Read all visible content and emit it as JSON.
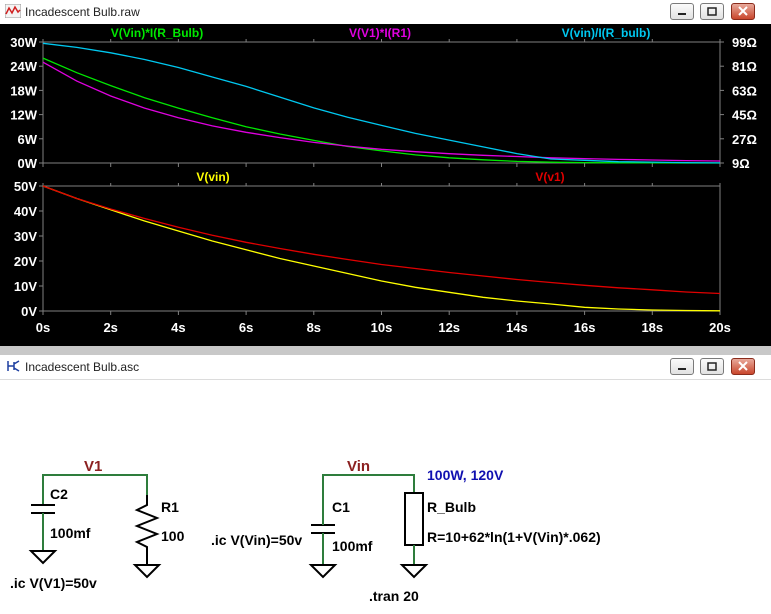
{
  "waveform_window": {
    "title": "Incadescent Bulb.raw",
    "controls": {
      "minimize": "minimize",
      "restore": "restore",
      "close": "close"
    }
  },
  "schematic_window": {
    "title": "Incadescent Bulb.asc",
    "controls": {
      "minimize": "minimize",
      "restore": "restore",
      "close": "close"
    },
    "nets": {
      "v1": "V1",
      "vin": "Vin"
    },
    "components": {
      "c2": {
        "name": "C2",
        "value": "100mf"
      },
      "r1": {
        "name": "R1",
        "value": "100"
      },
      "c1": {
        "name": "C1",
        "value": "100mf"
      },
      "r_bulb": {
        "name": "R_Bulb",
        "value": "R=10+62*ln(1+V(Vin)*.062)",
        "rating": "100W, 120V"
      }
    },
    "directives": {
      "ic_v1": ".ic V(V1)=50v",
      "ic_vin": ".ic V(Vin)=50v",
      "tran": ".tran 20"
    }
  },
  "colors": {
    "background": "#000000",
    "axis": "#808080",
    "label": "#ffffff",
    "green": "#00e800",
    "magenta": "#e000e0",
    "cyan": "#00c8f0",
    "yellow": "#ffff00",
    "red": "#e00000",
    "netlabel": "#8b2020",
    "rating": "#1010b0",
    "wire": "#2e7d3c"
  },
  "chart_data": [
    {
      "type": "line",
      "title": "",
      "x_ticks": [
        "0s",
        "2s",
        "4s",
        "6s",
        "8s",
        "10s",
        "12s",
        "14s",
        "16s",
        "18s",
        "20s"
      ],
      "xlim": [
        0,
        20
      ],
      "ylim_left": [
        0,
        30
      ],
      "y_ticks_left": [
        "0W",
        "6W",
        "12W",
        "18W",
        "24W",
        "30W"
      ],
      "ylim_right": [
        9,
        99
      ],
      "y_ticks_right": [
        "9Ω",
        "27Ω",
        "45Ω",
        "63Ω",
        "81Ω",
        "99Ω"
      ],
      "series": [
        {
          "name": "V(Vin)*I(R_Bulb)",
          "color": "#00e800",
          "axis": "left",
          "x": [
            0,
            1,
            2,
            3,
            4,
            5,
            6,
            7,
            8,
            9,
            10,
            11,
            12,
            13,
            14,
            15,
            16,
            17,
            18,
            19,
            20
          ],
          "y": [
            26,
            22.4,
            19.2,
            16.2,
            13.6,
            11.2,
            9,
            7.2,
            5.6,
            4.1,
            3,
            2,
            1.3,
            0.8,
            0.4,
            0.2,
            0.1,
            0.05,
            0.02,
            0,
            0
          ]
        },
        {
          "name": "V(V1)*I(R1)",
          "color": "#e000e0",
          "axis": "left",
          "x": [
            0,
            1,
            2,
            3,
            4,
            5,
            6,
            7,
            8,
            9,
            10,
            11,
            12,
            13,
            14,
            15,
            16,
            17,
            18,
            19,
            20
          ],
          "y": [
            25,
            20.3,
            16.6,
            13.6,
            11.2,
            9.2,
            7.6,
            6.3,
            5.1,
            4.2,
            3.4,
            2.8,
            2.3,
            1.9,
            1.6,
            1.3,
            1.1,
            0.9,
            0.75,
            0.6,
            0.5
          ]
        },
        {
          "name": "V(vin)/I(R_bulb)",
          "color": "#00c8f0",
          "axis": "right",
          "x": [
            0,
            1,
            2,
            3,
            4,
            5,
            6,
            7,
            8,
            9,
            10,
            11,
            12,
            13,
            14,
            15,
            16,
            17,
            18,
            19,
            20
          ],
          "y": [
            98,
            95,
            91,
            86,
            80,
            73,
            66,
            58,
            50,
            43,
            37,
            31,
            26,
            21,
            16,
            12,
            11,
            10,
            9.7,
            9.3,
            9.1
          ]
        }
      ]
    },
    {
      "type": "line",
      "title": "",
      "x_ticks": [
        "0s",
        "2s",
        "4s",
        "6s",
        "8s",
        "10s",
        "12s",
        "14s",
        "16s",
        "18s",
        "20s"
      ],
      "xlim": [
        0,
        20
      ],
      "ylim": [
        0,
        50
      ],
      "y_ticks": [
        "0V",
        "10V",
        "20V",
        "30V",
        "40V",
        "50V"
      ],
      "series": [
        {
          "name": "V(vin)",
          "color": "#ffff00",
          "x": [
            0,
            1,
            2,
            3,
            4,
            5,
            6,
            7,
            8,
            9,
            10,
            11,
            12,
            13,
            14,
            15,
            16,
            17,
            18,
            19,
            20
          ],
          "y": [
            50,
            45,
            40.5,
            36,
            32,
            28,
            24.5,
            21,
            18,
            15,
            12,
            9.5,
            7.5,
            5.5,
            4,
            2.8,
            1.5,
            0.8,
            0.4,
            0.2,
            0.1
          ]
        },
        {
          "name": "V(v1)",
          "color": "#e00000",
          "x": [
            0,
            1,
            2,
            3,
            4,
            5,
            6,
            7,
            8,
            9,
            10,
            11,
            12,
            13,
            14,
            15,
            16,
            17,
            18,
            19,
            20
          ],
          "y": [
            50,
            45,
            40.8,
            37,
            33.5,
            30.3,
            27.5,
            25,
            22.7,
            20.6,
            18.6,
            17,
            15.4,
            14,
            12.6,
            11.4,
            10.3,
            9.3,
            8.5,
            7.6,
            7
          ]
        }
      ]
    }
  ]
}
